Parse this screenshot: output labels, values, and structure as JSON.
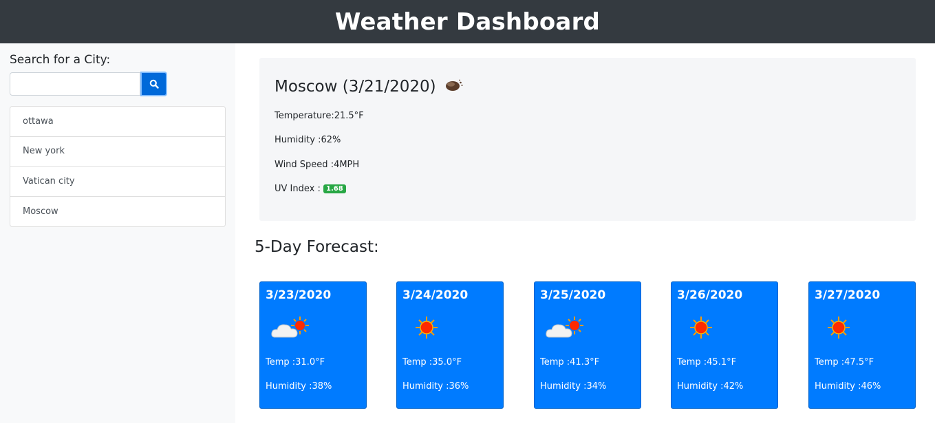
{
  "header": {
    "title": "Weather Dashboard"
  },
  "search": {
    "label": "Search for a City:",
    "value": "",
    "placeholder": "",
    "button_icon": "search-icon"
  },
  "history": [
    {
      "label": "ottawa"
    },
    {
      "label": "New york"
    },
    {
      "label": "Vatican city"
    },
    {
      "label": "Moscow"
    }
  ],
  "current": {
    "title": "Moscow (3/21/2020)",
    "icon": "night-cloud-icon",
    "temperature": "Temperature:21.5°F",
    "humidity": "Humidity :62%",
    "wind": "Wind Speed :4MPH",
    "uv_label": "UV Index :",
    "uv_value": "1.68",
    "uv_color": "#28a745"
  },
  "forecast": {
    "title": "5-Day Forecast:",
    "days": [
      {
        "date": "3/23/2020",
        "icon": "partly-cloudy-icon",
        "temp": "Temp :31.0°F",
        "humidity": "Humidity :38%"
      },
      {
        "date": "3/24/2020",
        "icon": "sun-icon",
        "temp": "Temp :35.0°F",
        "humidity": "Humidity :36%"
      },
      {
        "date": "3/25/2020",
        "icon": "partly-cloudy-icon",
        "temp": "Temp :41.3°F",
        "humidity": "Humidity :34%"
      },
      {
        "date": "3/26/2020",
        "icon": "sun-icon",
        "temp": "Temp :45.1°F",
        "humidity": "Humidity :42%"
      },
      {
        "date": "3/27/2020",
        "icon": "sun-icon",
        "temp": "Temp :47.5°F",
        "humidity": "Humidity :46%"
      }
    ]
  },
  "colors": {
    "header_bg": "#343a40",
    "card_bg": "#007bff",
    "search_button": "#0069d9"
  }
}
